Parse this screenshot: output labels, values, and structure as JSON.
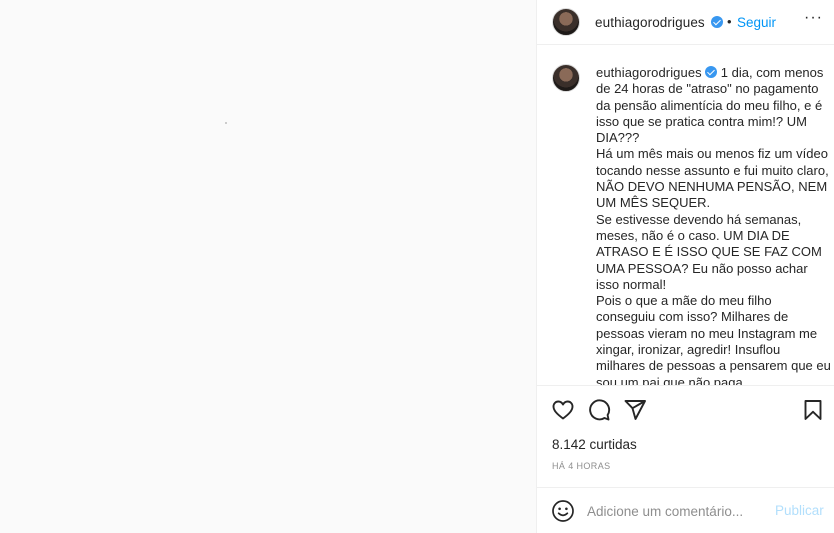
{
  "header": {
    "username": "euthiagorodrigues",
    "separator": "•",
    "follow_label": "Seguir",
    "more_label": "···"
  },
  "caption": {
    "username": "euthiagorodrigues",
    "text": "1 dia, com menos de 24 horas de \"atraso\" no pagamento da pensão alimentícia do meu filho, e é isso que se pratica contra mim!? UM DIA???\nHá um mês mais ou menos fiz um vídeo tocando nesse assunto e fui muito claro, NÃO DEVO NENHUMA PENSÃO, NEM UM MÊS SEQUER.\nSe estivesse devendo há semanas, meses, não é o caso. UM DIA DE ATRASO E É ISSO QUE SE FAZ COM UMA PESSOA? Eu não posso achar isso normal!\nPois o que a mãe do meu filho conseguiu com isso? Milhares de pessoas vieram no meu Instagram me xingar, ironizar, agredir! Insuflou milhares de pessoas a pensarem que eu sou um pai que não paga"
  },
  "actions": {
    "icons": [
      "heart-icon",
      "comment-icon",
      "share-icon",
      "bookmark-icon"
    ]
  },
  "likes": "8.142 curtidas",
  "time": "HÁ 4 HORAS",
  "comment_box": {
    "placeholder": "Adicione um comentário...",
    "post_label": "Publicar"
  },
  "colors": {
    "accent": "#0095f6",
    "verified": "#3897f0",
    "post_disabled": "#b2dffc",
    "muted": "#8e8e8e"
  }
}
